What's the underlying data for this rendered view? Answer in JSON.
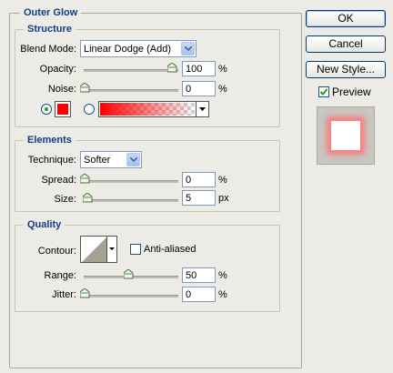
{
  "dialog": {
    "panel_title": "Outer Glow",
    "structure": {
      "title": "Structure",
      "blend_mode_label": "Blend Mode:",
      "blend_mode_value": "Linear Dodge (Add)",
      "opacity_label": "Opacity:",
      "opacity_value": "100",
      "opacity_unit": "%",
      "opacity_level": 1.0,
      "noise_label": "Noise:",
      "noise_value": "0",
      "noise_unit": "%",
      "noise_level": 0.0,
      "color_mode": "solid",
      "solid_color": "#ff0000"
    },
    "elements": {
      "title": "Elements",
      "technique_label": "Technique:",
      "technique_value": "Softer",
      "spread_label": "Spread:",
      "spread_value": "0",
      "spread_unit": "%",
      "size_label": "Size:",
      "size_value": "5",
      "size_unit": "px"
    },
    "quality": {
      "title": "Quality",
      "contour_label": "Contour:",
      "anti_aliased_label": "Anti-aliased",
      "anti_aliased_checked": false,
      "range_label": "Range:",
      "range_value": "50",
      "range_unit": "%",
      "range_level": 0.5,
      "jitter_label": "Jitter:",
      "jitter_value": "0",
      "jitter_unit": "%",
      "jitter_level": 0.0
    },
    "buttons": {
      "ok": "OK",
      "cancel": "Cancel",
      "new_style": "New Style...",
      "preview_label": "Preview",
      "preview_checked": true
    },
    "colors": {
      "accent_title": "#123c8c",
      "glow": "#ff0000"
    }
  }
}
